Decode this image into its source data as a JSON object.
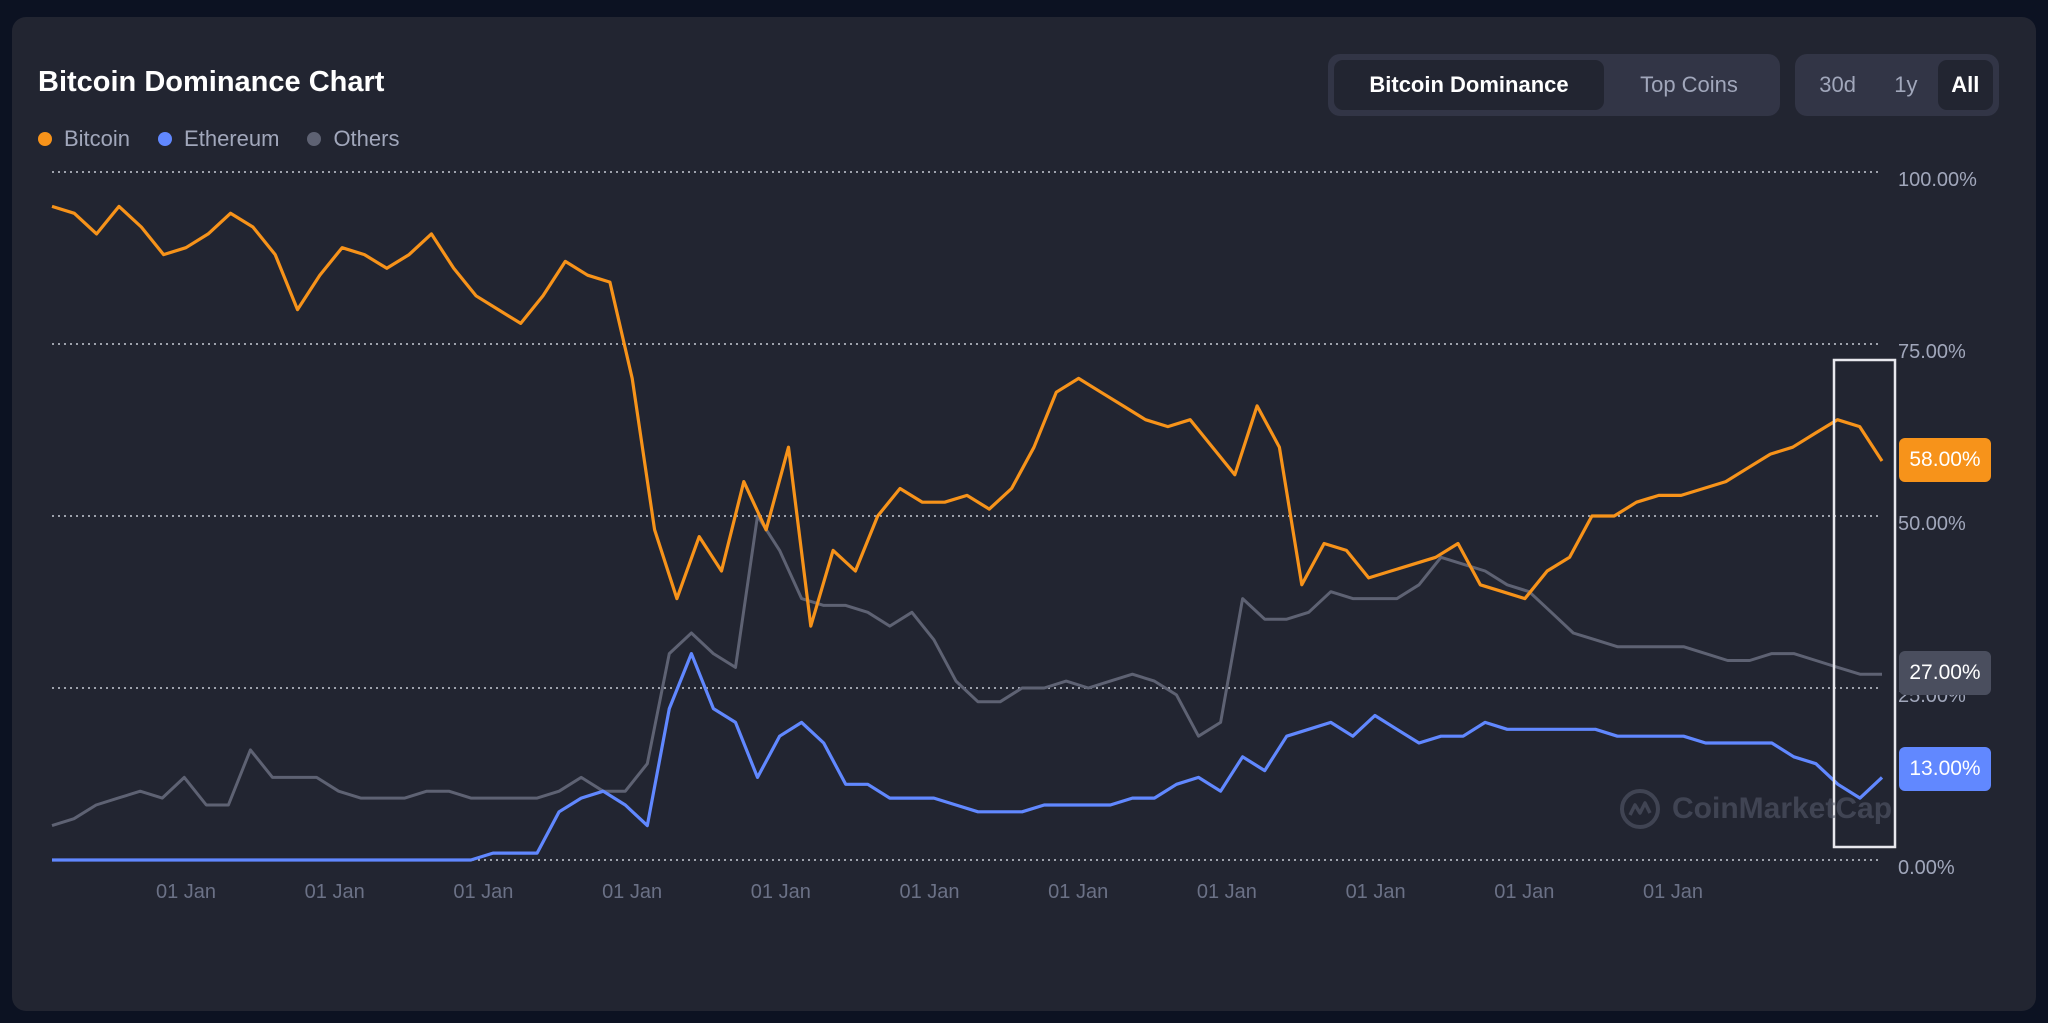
{
  "header": {
    "title": "Bitcoin Dominance Chart"
  },
  "tabs": [
    {
      "label": "Bitcoin Dominance",
      "active": true
    },
    {
      "label": "Top Coins",
      "active": false
    }
  ],
  "ranges": [
    {
      "label": "30d",
      "active": false
    },
    {
      "label": "1y",
      "active": false
    },
    {
      "label": "All",
      "active": true
    }
  ],
  "colors": {
    "bitcoin": "#f7931a",
    "ethereum": "#6188ff",
    "others": "#5e6273"
  },
  "watermark": "CoinMarketCap",
  "badges": {
    "bitcoin": "58.00%",
    "others": "27.00%",
    "ethereum": "13.00%"
  },
  "chart_data": {
    "type": "line",
    "title": "Bitcoin Dominance Chart",
    "y_ticks": [
      "100.00%",
      "75.00%",
      "50.00%",
      "25.00%",
      "0.00%"
    ],
    "ylim": [
      0,
      100
    ],
    "x_ticks": [
      "01 Jan",
      "01 Jan",
      "01 Jan",
      "01 Jan",
      "01 Jan",
      "01 Jan",
      "01 Jan",
      "01 Jan",
      "01 Jan",
      "01 Jan",
      "01 Jan"
    ],
    "grid": true,
    "legend": "top-left",
    "series": [
      {
        "name": "Bitcoin",
        "color": "#f7931a",
        "values": [
          95,
          94,
          91,
          95,
          92,
          88,
          89,
          91,
          94,
          92,
          88,
          80,
          85,
          89,
          88,
          86,
          88,
          91,
          86,
          82,
          80,
          78,
          82,
          87,
          85,
          84,
          70,
          48,
          38,
          47,
          42,
          55,
          48,
          60,
          34,
          45,
          42,
          50,
          54,
          52,
          52,
          53,
          51,
          54,
          60,
          68,
          70,
          68,
          66,
          64,
          63,
          64,
          60,
          56,
          66,
          60,
          40,
          46,
          45,
          41,
          42,
          43,
          44,
          46,
          40,
          39,
          38,
          42,
          44,
          50,
          50,
          52,
          53,
          53,
          54,
          55,
          57,
          59,
          60,
          62,
          64,
          63,
          58
        ]
      },
      {
        "name": "Ethereum",
        "color": "#6188ff",
        "values": [
          0,
          0,
          0,
          0,
          0,
          0,
          0,
          0,
          0,
          0,
          0,
          0,
          0,
          0,
          0,
          0,
          0,
          0,
          0,
          0,
          1,
          1,
          1,
          7,
          9,
          10,
          8,
          5,
          22,
          30,
          22,
          20,
          12,
          18,
          20,
          17,
          11,
          11,
          9,
          9,
          9,
          8,
          7,
          7,
          7,
          8,
          8,
          8,
          8,
          9,
          9,
          11,
          12,
          10,
          15,
          13,
          18,
          19,
          20,
          18,
          21,
          19,
          17,
          18,
          18,
          20,
          19,
          19,
          19,
          19,
          19,
          18,
          18,
          18,
          18,
          17,
          17,
          17,
          17,
          15,
          14,
          11,
          9,
          12
        ]
      },
      {
        "name": "Others",
        "color": "#5e6273",
        "values": [
          5,
          6,
          8,
          9,
          10,
          9,
          12,
          8,
          8,
          16,
          12,
          12,
          12,
          10,
          9,
          9,
          9,
          10,
          10,
          9,
          9,
          9,
          9,
          10,
          12,
          10,
          10,
          14,
          30,
          33,
          30,
          28,
          50,
          45,
          38,
          37,
          37,
          36,
          34,
          36,
          32,
          26,
          23,
          23,
          25,
          25,
          26,
          25,
          26,
          27,
          26,
          24,
          18,
          20,
          38,
          35,
          35,
          36,
          39,
          38,
          38,
          38,
          40,
          44,
          43,
          42,
          40,
          39,
          36,
          33,
          32,
          31,
          31,
          31,
          31,
          30,
          29,
          29,
          30,
          30,
          29,
          28,
          27,
          27
        ]
      }
    ]
  }
}
